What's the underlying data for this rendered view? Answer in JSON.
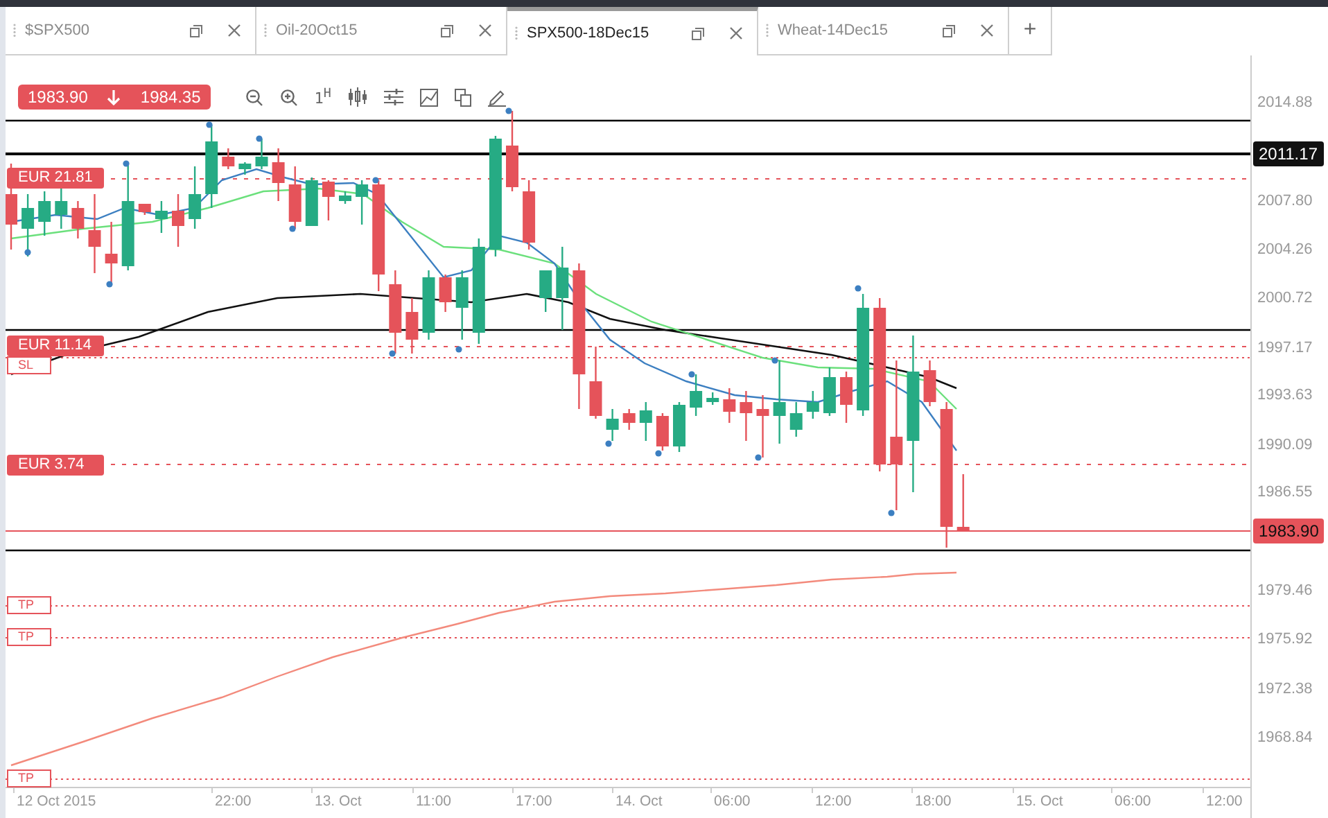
{
  "tabs": [
    {
      "label": "$SPX500",
      "selected": false
    },
    {
      "label": "Oil-20Oct15",
      "selected": false
    },
    {
      "label": "SPX500-18Dec15",
      "selected": true
    },
    {
      "label": "Wheat-14Dec15",
      "selected": false
    }
  ],
  "new_tab_button": "+",
  "price_badge": {
    "bid": "1983.90",
    "ask": "1984.35"
  },
  "toolbar": {
    "interval": "1$^{H}$"
  },
  "order_labels": [
    {
      "text": "EUR 21.81",
      "kind": "filled"
    },
    {
      "text": "EUR 11.14",
      "kind": "filled"
    },
    {
      "text": "SL",
      "kind": "outlined"
    },
    {
      "text": "EUR 3.74",
      "kind": "filled"
    },
    {
      "text": "TP",
      "kind": "outlined"
    },
    {
      "text": "TP",
      "kind": "outlined"
    },
    {
      "text": "TP",
      "kind": "outlined"
    }
  ],
  "price_axis": {
    "labels": [
      "2014.88",
      "2007.80",
      "2004.26",
      "2000.72",
      "1997.17",
      "1993.63",
      "1990.09",
      "1986.55",
      "1979.46",
      "1975.92",
      "1972.38",
      "1968.84"
    ],
    "markers": [
      {
        "text": "2011.17",
        "kind": "level"
      },
      {
        "text": "1983.90",
        "kind": "current"
      }
    ]
  },
  "time_axis": {
    "labels": [
      "12 Oct 2015",
      "22:00",
      "13. Oct",
      "11:00",
      "17:00",
      "14. Oct",
      "06:00",
      "12:00",
      "18:00",
      "15. Oct",
      "06:00",
      "12:00"
    ]
  }
}
